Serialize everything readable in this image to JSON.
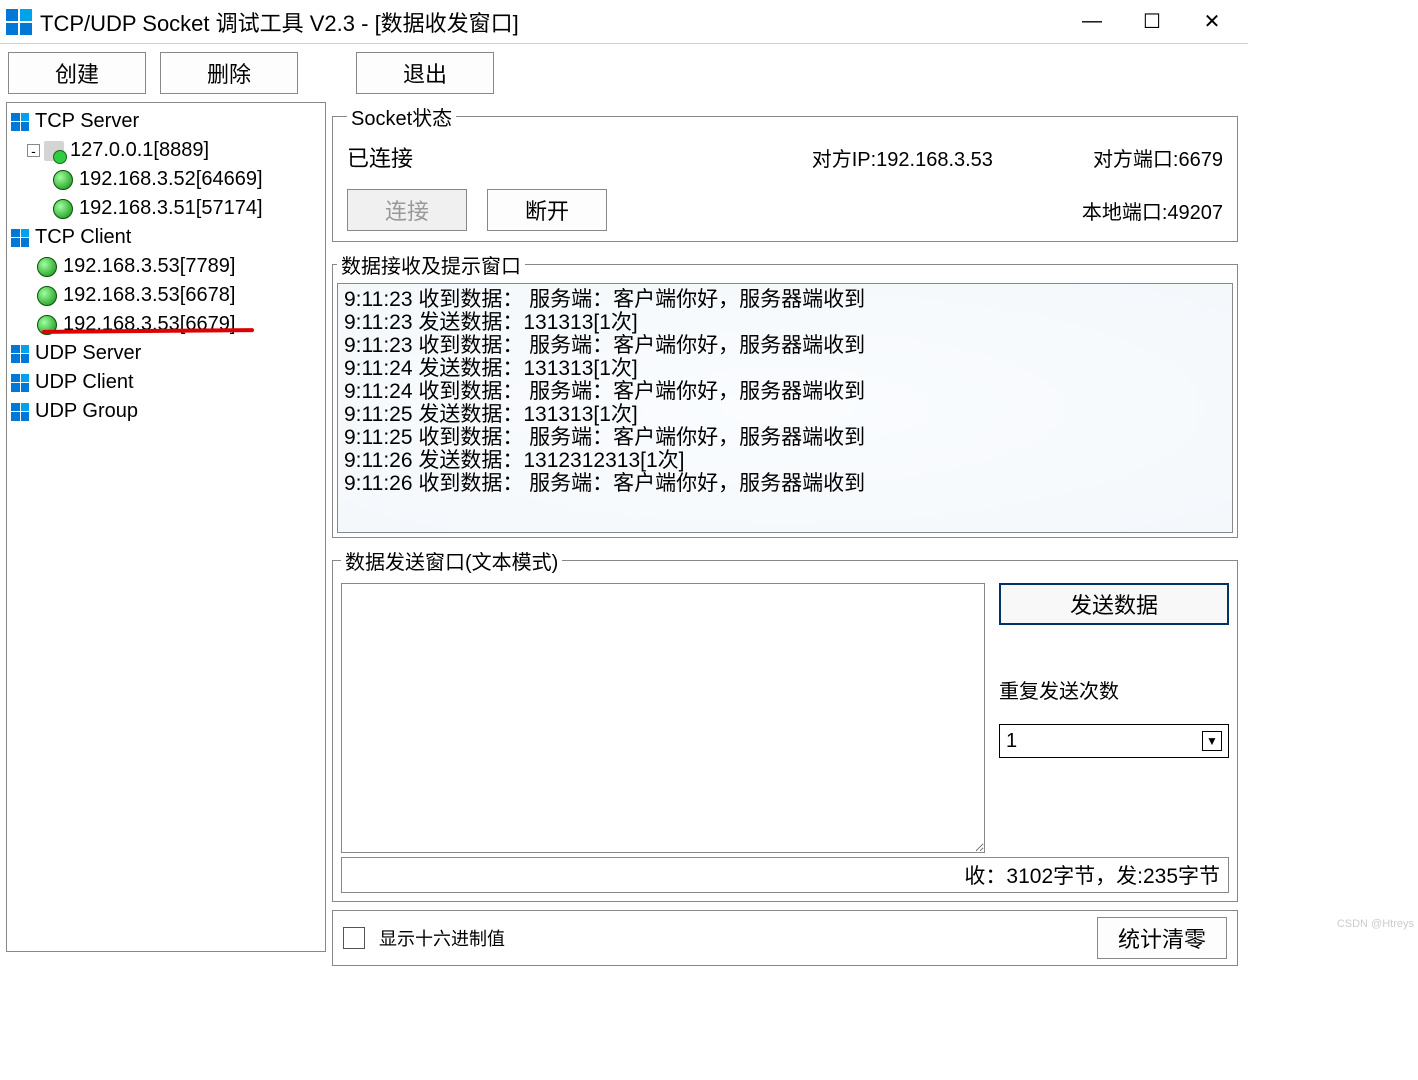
{
  "window": {
    "title": "TCP/UDP Socket 调试工具 V2.3  - [数据收发窗口]"
  },
  "toolbar": {
    "create": "创建",
    "delete": "删除",
    "exit": "退出"
  },
  "tree": {
    "tcp_server": "TCP Server",
    "srv_node": "127.0.0.1[8889]",
    "srv_children": [
      "192.168.3.52[64669]",
      "192.168.3.51[57174]"
    ],
    "tcp_client": "TCP Client",
    "cli_children": [
      "192.168.3.53[7789]",
      "192.168.3.53[6678]",
      "192.168.3.53[6679]"
    ],
    "udp_server": "UDP Server",
    "udp_client": "UDP Client",
    "udp_group": "UDP Group"
  },
  "status": {
    "legend": "Socket状态",
    "state": "已连接",
    "peer_ip_label": "对方IP:192.168.3.53",
    "peer_port_label": "对方端口:6679",
    "connect": "连接",
    "disconnect": "断开",
    "local_port_label": "本地端口:49207"
  },
  "recv": {
    "legend": "数据接收及提示窗口",
    "lines": [
      "9:11:23 收到数据：  服务端：客户端你好，服务器端收到",
      "9:11:23 发送数据：131313[1次]",
      "9:11:23 收到数据：  服务端：客户端你好，服务器端收到",
      "9:11:24 发送数据：131313[1次]",
      "9:11:24 收到数据：  服务端：客户端你好，服务器端收到",
      "9:11:25 发送数据：131313[1次]",
      "9:11:25 收到数据：  服务端：客户端你好，服务器端收到",
      "9:11:26 发送数据：1312312313[1次]",
      "9:11:26 收到数据：  服务端：客户端你好，服务器端收到"
    ]
  },
  "send": {
    "legend": "数据发送窗口(文本模式)",
    "send_btn": "发送数据",
    "repeat_label": "重复发送次数",
    "repeat_value": "1",
    "stats": "收：3102字节，发:235字节"
  },
  "bottom": {
    "hex_label": "显示十六进制值",
    "clear": "统计清零"
  },
  "watermark": "CSDN @Htreys"
}
